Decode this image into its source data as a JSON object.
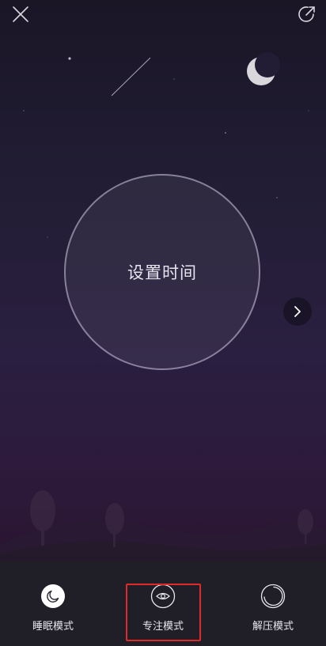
{
  "timer": {
    "label": "设置时间"
  },
  "modes": [
    {
      "label": "睡眠模式",
      "icon": "moon-icon",
      "selected": false
    },
    {
      "label": "专注模式",
      "icon": "eye-icon",
      "selected": true
    },
    {
      "label": "解压模式",
      "icon": "ring-icon",
      "selected": false
    }
  ],
  "icons": {
    "close": "close-icon",
    "share": "share-icon",
    "next": "chevron-right-icon"
  },
  "colors": {
    "highlight": "#e02a2a",
    "bar_background": "#201e26"
  }
}
